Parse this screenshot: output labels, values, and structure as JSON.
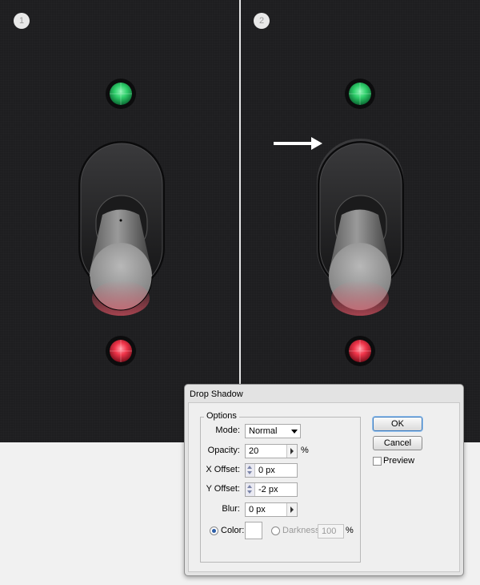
{
  "steps": [
    "1",
    "2"
  ],
  "dialog": {
    "title": "Drop Shadow",
    "options_legend": "Options",
    "mode": {
      "label": "Mode:",
      "value": "Normal"
    },
    "opacity": {
      "label": "Opacity:",
      "value": "20",
      "unit": "%"
    },
    "x_offset": {
      "label": "X Offset:",
      "value": "0 px"
    },
    "y_offset": {
      "label": "Y Offset:",
      "value": "-2 px"
    },
    "blur": {
      "label": "Blur:",
      "value": "0 px"
    },
    "color": {
      "label": "Color:",
      "selected": true,
      "swatch": "#ffffff"
    },
    "darkness": {
      "label": "Darkness:",
      "value": "100",
      "unit": "%"
    },
    "buttons": {
      "ok": "OK",
      "cancel": "Cancel"
    },
    "preview": {
      "label": "Preview",
      "checked": false
    }
  },
  "colors": {
    "panel_bg": "#1e1e20",
    "led_green": "#2fd06b",
    "led_red": "#f0354a",
    "arrow": "#ffffff"
  },
  "icons": [
    "arrow-right-icon",
    "toggle-switch",
    "led-green",
    "led-red"
  ]
}
